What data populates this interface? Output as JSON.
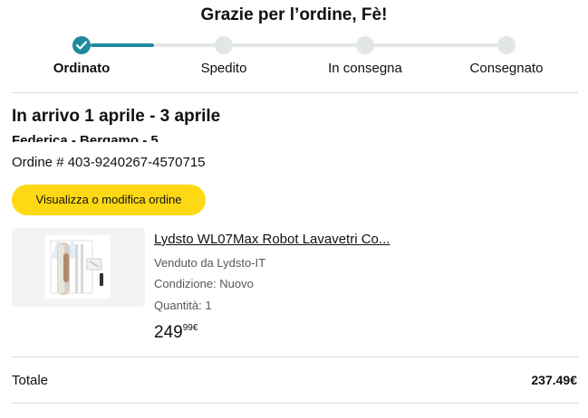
{
  "header": {
    "title": "Grazie per l’ordine, Fè!"
  },
  "tracker": {
    "steps": [
      {
        "label": "Ordinato",
        "state": "completed"
      },
      {
        "label": "Spedito",
        "state": "pending"
      },
      {
        "label": "In consegna",
        "state": "pending"
      },
      {
        "label": "Consegnato",
        "state": "pending"
      }
    ],
    "accent_color": "#1f8a9c",
    "inactive_color": "#e3e6e6"
  },
  "delivery": {
    "arrival": "In arrivo 1 aprile - 3 aprile",
    "recipient": "Federica - Bergamo - 5",
    "order_number": "Ordine # 403-9240267-4570715"
  },
  "actions": {
    "view_order_label": "Visualizza o modifica ordine",
    "button_color": "#ffd814"
  },
  "product": {
    "title": "Lydsto WL07Max Robot Lavavetri Co...",
    "seller": "Venduto da Lydsto-IT",
    "condition": "Condizione: Nuovo",
    "quantity": "Quantità: 1",
    "price_whole": "249",
    "price_fraction": "99€",
    "image_icon": "robot-window-cleaner-product-image"
  },
  "summary": {
    "total_label": "Totale",
    "total_value": "237.49€"
  }
}
